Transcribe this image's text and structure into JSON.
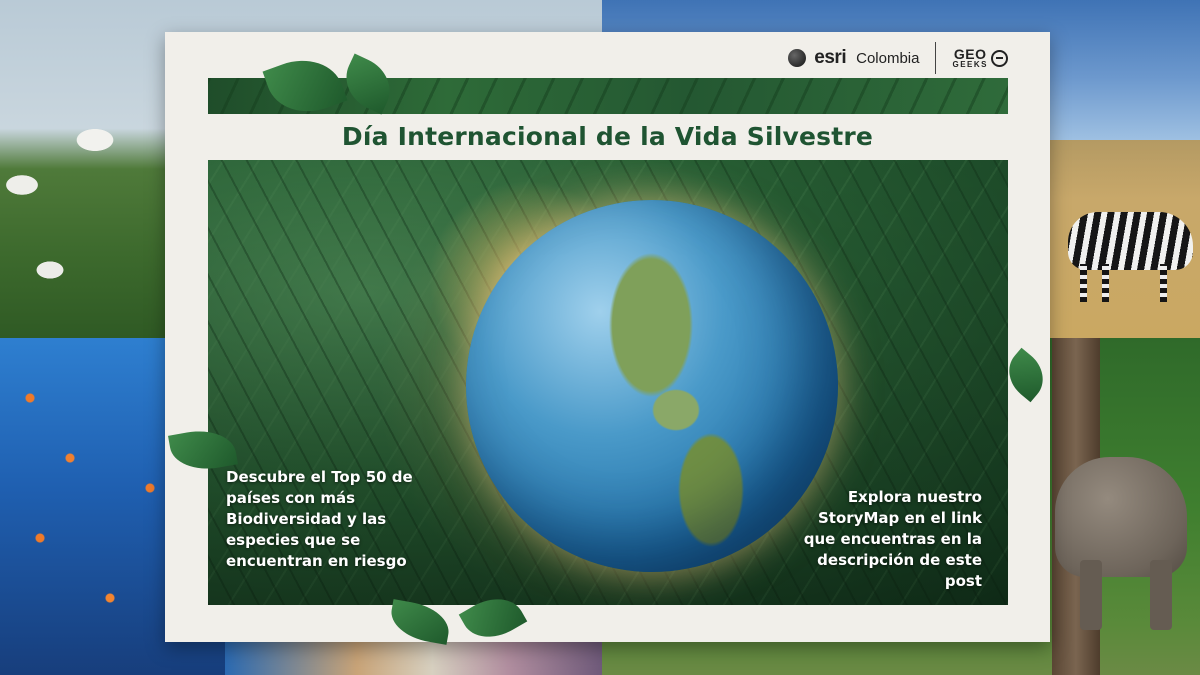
{
  "brand": {
    "esri": "esri",
    "country": "Colombia",
    "geo_top": "GEO",
    "geo_bottom": "GEEKS"
  },
  "title": "Día Internacional de la Vida Silvestre",
  "left_text": "Descubre el Top 50 de países con más Biodiversidad  y las especies que se encuentran en riesgo",
  "right_text": "Explora nuestro StoryMap en el link que encuentras en la descripción de este post",
  "colors": {
    "title_green": "#1f5432",
    "card_bg": "#f1efea",
    "text_white": "#ffffff"
  }
}
